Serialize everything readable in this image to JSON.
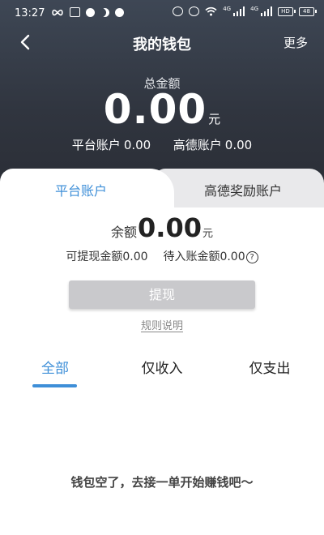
{
  "status_bar": {
    "time": "13:27",
    "left_icons": [
      "infinity-icon",
      "app-icon",
      "message-icon",
      "moon-icon",
      "app-icon-2"
    ],
    "right_icons": [
      "no-disturb-icon",
      "alarm-icon",
      "wifi-icon",
      "signal-icon",
      "signal-icon-2",
      "hd-icon",
      "battery-icon"
    ],
    "signal_label_1": "4G",
    "signal_label_2": "4G",
    "hd_label": "HD",
    "battery_level": "48"
  },
  "nav": {
    "back_icon": "chevron-left-icon",
    "title": "我的钱包",
    "more_label": "更多"
  },
  "summary": {
    "total_label": "总金额",
    "total_amount": "0.00",
    "total_unit": "元",
    "platform_account_label": "平台账户",
    "platform_account_value": "0.00",
    "gaode_account_label": "高德账户",
    "gaode_account_value": "0.00"
  },
  "account_tabs": {
    "active": "平台账户",
    "inactive": "高德奖励账户"
  },
  "balance": {
    "label": "余额",
    "amount": "0.00",
    "unit": "元",
    "withdrawable_label": "可提现金额",
    "withdrawable_value": "0.00",
    "pending_label": "待入账金额",
    "pending_value": "0.00",
    "help_icon": "question-circle-icon"
  },
  "actions": {
    "withdraw_label": "提现",
    "rules_label": "规则说明"
  },
  "filters": {
    "items": [
      "全部",
      "仅收入",
      "仅支出"
    ],
    "active_index": 0
  },
  "empty_state": {
    "message": "钱包空了，去接一单开始赚钱吧～"
  },
  "colors": {
    "header_bg": "#333841",
    "accent": "#3e8fd8",
    "button_disabled": "#c9c9cc",
    "inactive_tab_bg": "#e9e9eb"
  }
}
